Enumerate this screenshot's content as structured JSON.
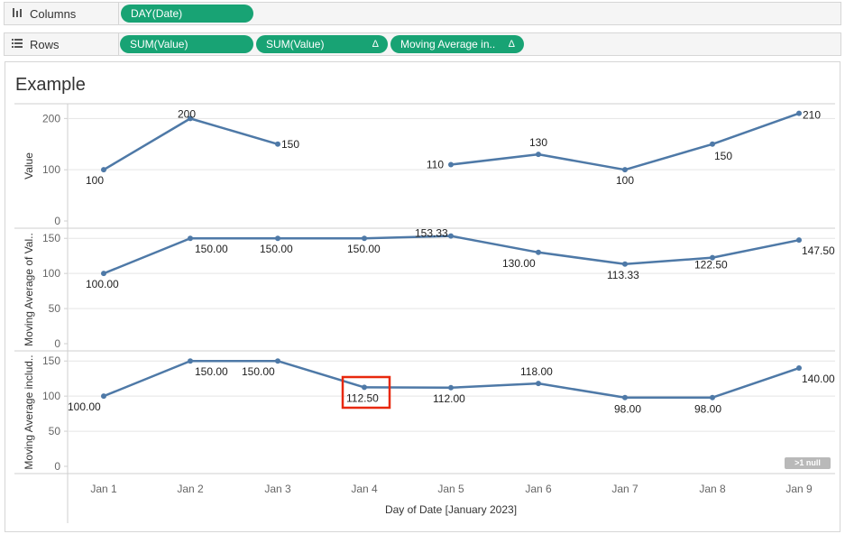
{
  "shelves": {
    "columns": {
      "label": "Columns",
      "icon": "columns-icon",
      "pills": [
        {
          "label": "DAY(Date)"
        }
      ]
    },
    "rows": {
      "label": "Rows",
      "icon": "rows-icon",
      "pills": [
        {
          "label": "SUM(Value)"
        },
        {
          "label": "SUM(Value)",
          "delta": "Δ"
        },
        {
          "label": "Moving Average in..",
          "delta": "Δ"
        }
      ]
    }
  },
  "sheet": {
    "title": "Example",
    "null_indicator": ">1 null",
    "highlight_label": "112.50"
  },
  "colors": {
    "line": "#4e79a7",
    "pill": "#18a374",
    "highlight": "#e8280d",
    "grid": "#e5e5e5"
  },
  "chart_data": [
    {
      "type": "line",
      "ylabel": "Value",
      "ylim": [
        0,
        220
      ],
      "yticks": [
        0,
        100,
        200
      ],
      "categories": [
        "Jan 1",
        "Jan 2",
        "Jan 3",
        "Jan 4",
        "Jan 5",
        "Jan 6",
        "Jan 7",
        "Jan 8",
        "Jan 9"
      ],
      "values": [
        100,
        200,
        150,
        null,
        110,
        130,
        100,
        150,
        210
      ],
      "labels": [
        "100",
        "200",
        "150",
        "",
        "110",
        "130",
        "100",
        "150",
        "210"
      ]
    },
    {
      "type": "line",
      "ylabel": "Moving Average of Val..",
      "ylim": [
        0,
        158
      ],
      "yticks": [
        0,
        50,
        100,
        150
      ],
      "categories": [
        "Jan 1",
        "Jan 2",
        "Jan 3",
        "Jan 4",
        "Jan 5",
        "Jan 6",
        "Jan 7",
        "Jan 8",
        "Jan 9"
      ],
      "values": [
        100,
        150,
        150,
        150,
        153.33,
        130,
        113.33,
        122.5,
        147.5
      ],
      "labels": [
        "100.00",
        "150.00",
        "150.00",
        "150.00",
        "153.33",
        "130.00",
        "113.33",
        "122.50",
        "147.50"
      ]
    },
    {
      "type": "line",
      "ylabel": "Moving Average includ..",
      "ylim": [
        0,
        158
      ],
      "yticks": [
        0,
        50,
        100,
        150
      ],
      "categories": [
        "Jan 1",
        "Jan 2",
        "Jan 3",
        "Jan 4",
        "Jan 5",
        "Jan 6",
        "Jan 7",
        "Jan 8",
        "Jan 9"
      ],
      "values": [
        100,
        150,
        150,
        112.5,
        112,
        118,
        98,
        98,
        140
      ],
      "labels": [
        "100.00",
        "150.00",
        "150.00",
        "112.50",
        "112.00",
        "118.00",
        "98.00",
        "98.00",
        "140.00"
      ]
    }
  ],
  "x_axis": {
    "title": "Day of Date [January 2023]",
    "ticks": [
      "Jan 1",
      "Jan 2",
      "Jan 3",
      "Jan 4",
      "Jan 5",
      "Jan 6",
      "Jan 7",
      "Jan 8",
      "Jan 9"
    ]
  }
}
